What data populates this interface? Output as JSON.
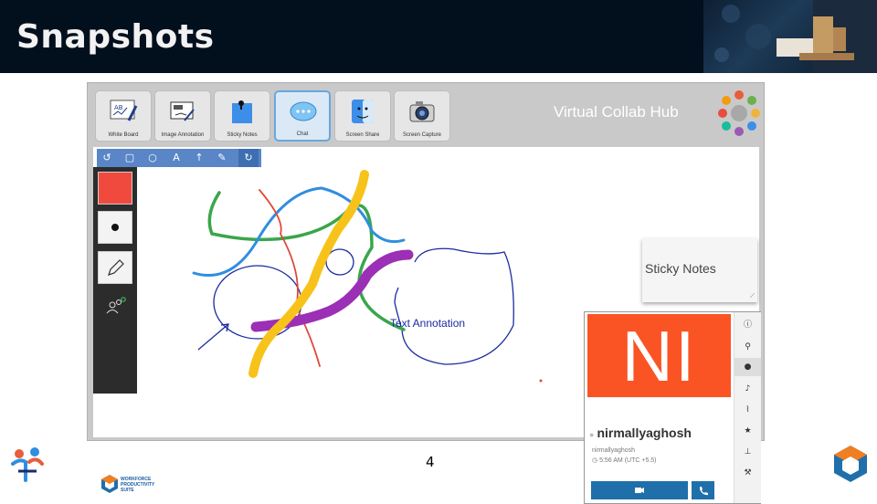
{
  "slide": {
    "title": "Snapshots",
    "page_number": "4"
  },
  "app": {
    "name": "Virtual Collab Hub",
    "toolbar": [
      {
        "label": "White Board",
        "icon": "whiteboard-icon"
      },
      {
        "label": "Image Annotation",
        "icon": "image-annotation-icon"
      },
      {
        "label": "Sticky Notes",
        "icon": "sticky-notes-icon"
      },
      {
        "label": "Chat",
        "icon": "chat-icon",
        "active": true
      },
      {
        "label": "Screen Share",
        "icon": "screen-share-icon"
      },
      {
        "label": "Screen Capture",
        "icon": "screen-capture-icon"
      }
    ],
    "draw_tools": [
      "undo-icon",
      "rectangle-icon",
      "circle-icon",
      "text-icon",
      "arrow-icon",
      "pen-icon",
      "redo-icon"
    ],
    "current_color": "#f04a3e",
    "annotation_text": "Text Annotation",
    "sticky_note": {
      "text": "Sticky Notes"
    },
    "chat_profile": {
      "initials": "NI",
      "name": "nirmallyaghosh",
      "handle": "nirmallyaghosh",
      "time": "5:56 AM (UTC +5.5)"
    },
    "logo_text": [
      "WORKFORCE",
      "PRODUCTIVITY",
      "SUITE"
    ]
  },
  "colors": {
    "header_bg": "#020f1d",
    "avatar_bg": "#fb5424",
    "accent_blue": "#1f6fab",
    "toolbar_blue": "#5a86c7",
    "stroke_green": "#3aa64a",
    "stroke_yellow": "#f7c31a",
    "stroke_purple": "#9b2fb5",
    "stroke_navy": "#1b2aa0",
    "stroke_red": "#e0483a",
    "stroke_skyblue": "#2f8ee0"
  }
}
